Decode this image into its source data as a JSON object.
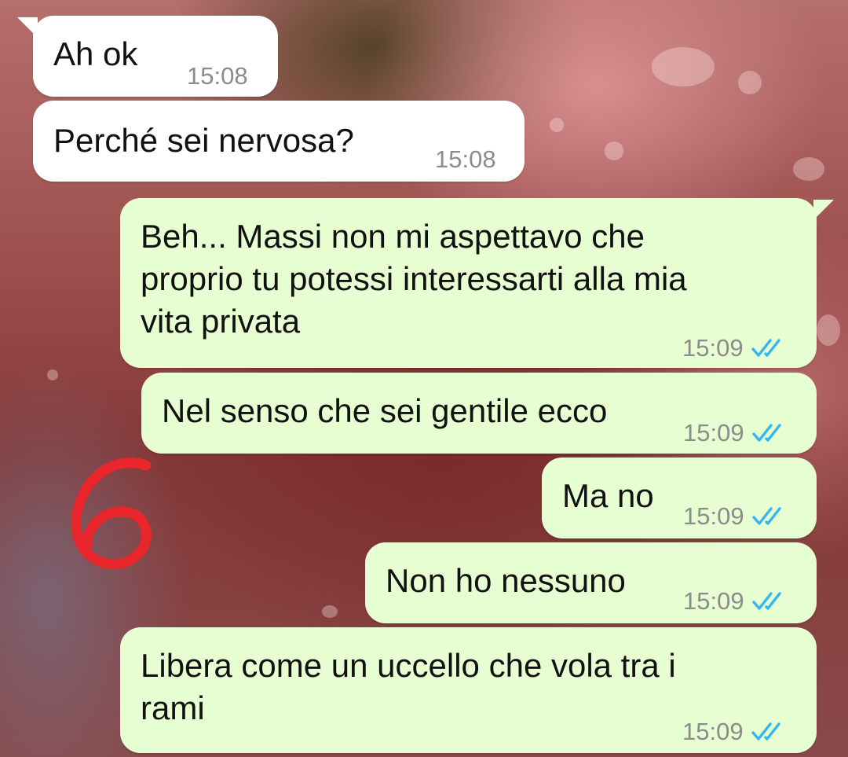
{
  "messages": [
    {
      "id": "m1",
      "direction": "in",
      "text": "Ah ok",
      "time": "15:08"
    },
    {
      "id": "m2",
      "direction": "in",
      "text": "Perché sei nervosa?",
      "time": "15:08"
    },
    {
      "id": "m3",
      "direction": "out",
      "text": "Beh... Massi non mi aspettavo che\nproprio tu potessi interessarti alla mia\nvita privata",
      "time": "15:09",
      "status": "read"
    },
    {
      "id": "m4",
      "direction": "out",
      "text": "Nel senso che sei gentile ecco",
      "time": "15:09",
      "status": "read"
    },
    {
      "id": "m5",
      "direction": "out",
      "text": "Ma no",
      "time": "15:09",
      "status": "read"
    },
    {
      "id": "m6",
      "direction": "out",
      "text": "Non ho nessuno",
      "time": "15:09",
      "status": "read"
    },
    {
      "id": "m7",
      "direction": "out",
      "text": "Libera come un uccello che vola tra i\nrami",
      "time": "15:09",
      "status": "read"
    }
  ],
  "annotation": {
    "text": "6",
    "color": "#e8262c"
  },
  "colors": {
    "incoming_bubble": "#ffffff",
    "outgoing_bubble": "#e7fed2",
    "read_ticks": "#34b7f1",
    "timestamp": "#8c8c8c"
  },
  "icons": {
    "read_receipt": "double-check-icon"
  }
}
